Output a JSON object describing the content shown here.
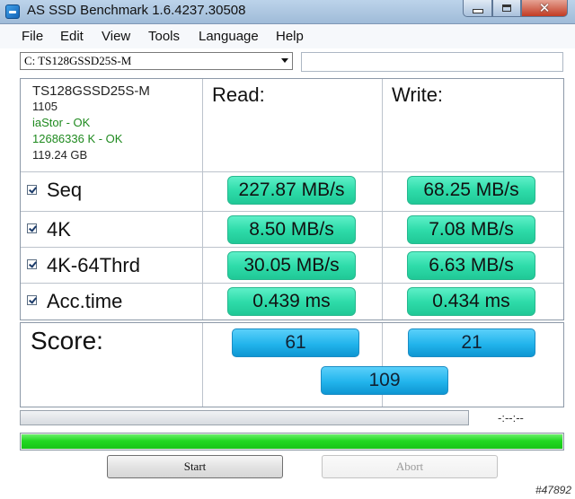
{
  "window": {
    "title": "AS SSD Benchmark 1.6.4237.30508"
  },
  "menu": [
    "File",
    "Edit",
    "View",
    "Tools",
    "Language",
    "Help"
  ],
  "drive_select": {
    "value": "C: TS128GSSD25S-M"
  },
  "drive_info": {
    "model": "TS128GSSD25S-M",
    "firmware": "1105",
    "driver": "iaStor - OK",
    "alignment": "12686336 K - OK",
    "capacity": "119.24 GB"
  },
  "headers": {
    "read": "Read:",
    "write": "Write:"
  },
  "tests": [
    {
      "label": "Seq",
      "read": "227.87 MB/s",
      "write": "68.25 MB/s",
      "checked": true
    },
    {
      "label": "4K",
      "read": "8.50 MB/s",
      "write": "7.08 MB/s",
      "checked": true
    },
    {
      "label": "4K-64Thrd",
      "read": "30.05 MB/s",
      "write": "6.63 MB/s",
      "checked": true
    },
    {
      "label": "Acc.time",
      "read": "0.439 ms",
      "write": "0.434 ms",
      "checked": true
    }
  ],
  "score": {
    "label": "Score:",
    "read": "61",
    "write": "21",
    "total": "109"
  },
  "status": {
    "time": "-:--:--",
    "progress_fraction": 1.0
  },
  "buttons": {
    "start": "Start",
    "abort": "Abort"
  },
  "watermark": "#47892",
  "colors": {
    "result_box": "#2fdcaa",
    "score_box": "#22b4ec",
    "progress": "#22d822"
  }
}
